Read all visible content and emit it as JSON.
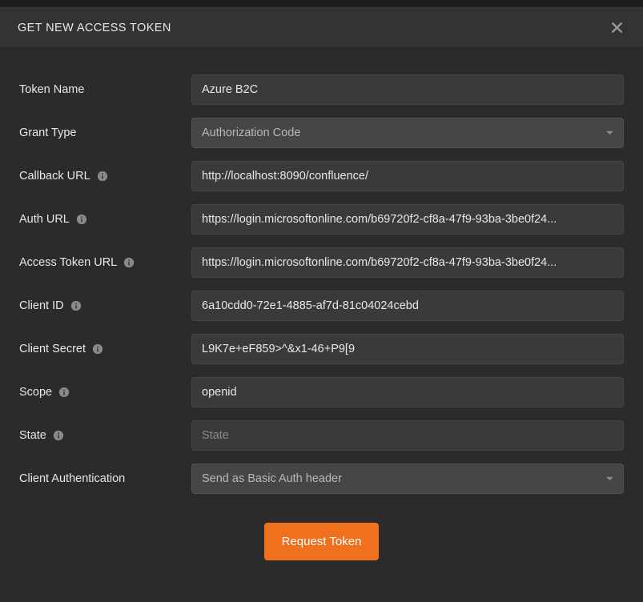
{
  "header": {
    "title": "GET NEW ACCESS TOKEN"
  },
  "form": {
    "token_name": {
      "label": "Token Name",
      "value": "Azure B2C"
    },
    "grant_type": {
      "label": "Grant Type",
      "selected": "Authorization Code"
    },
    "callback_url": {
      "label": "Callback URL",
      "value": "http://localhost:8090/confluence/"
    },
    "auth_url": {
      "label": "Auth URL",
      "value": "https://login.microsoftonline.com/b69720f2-cf8a-47f9-93ba-3be0f24..."
    },
    "access_token_url": {
      "label": "Access Token URL",
      "value": "https://login.microsoftonline.com/b69720f2-cf8a-47f9-93ba-3be0f24..."
    },
    "client_id": {
      "label": "Client ID",
      "value": "6a10cdd0-72e1-4885-af7d-81c04024cebd"
    },
    "client_secret": {
      "label": "Client Secret",
      "value": "L9K7e+eF859>^&x1-46+P9[9"
    },
    "scope": {
      "label": "Scope",
      "value": "openid"
    },
    "state": {
      "label": "State",
      "value": "",
      "placeholder": "State"
    },
    "client_auth": {
      "label": "Client Authentication",
      "selected": "Send as Basic Auth header"
    }
  },
  "actions": {
    "request_label": "Request Token"
  }
}
